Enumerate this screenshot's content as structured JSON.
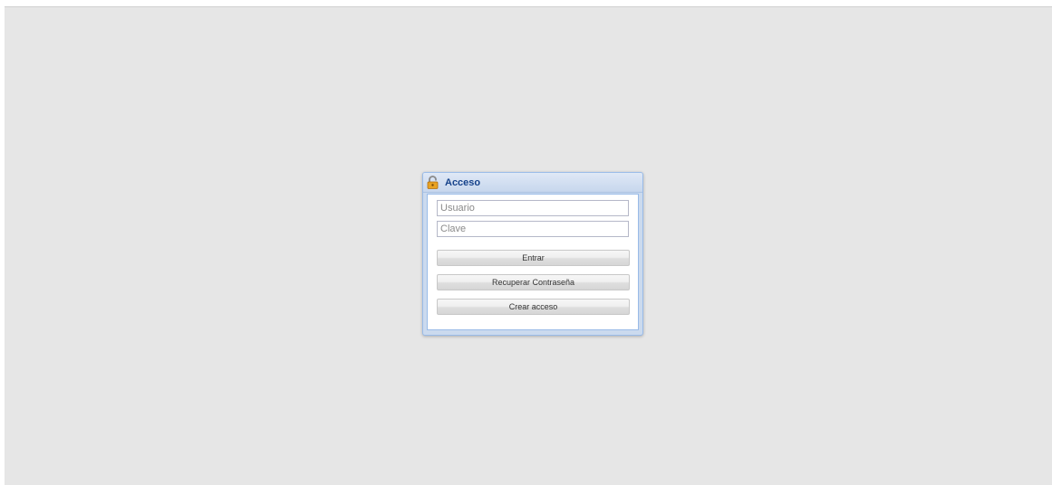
{
  "login_window": {
    "title": "Acceso",
    "title_icon": "lock-icon",
    "username": {
      "value": "",
      "placeholder": "Usuario"
    },
    "password": {
      "value": "",
      "placeholder": "Clave"
    },
    "buttons": {
      "login": "Entrar",
      "recover_password": "Recuperar Contraseña",
      "create_access": "Crear acceso"
    }
  },
  "colors": {
    "background": "#e6e6e6",
    "window_border": "#99bbe8",
    "title_text": "#15428b"
  }
}
